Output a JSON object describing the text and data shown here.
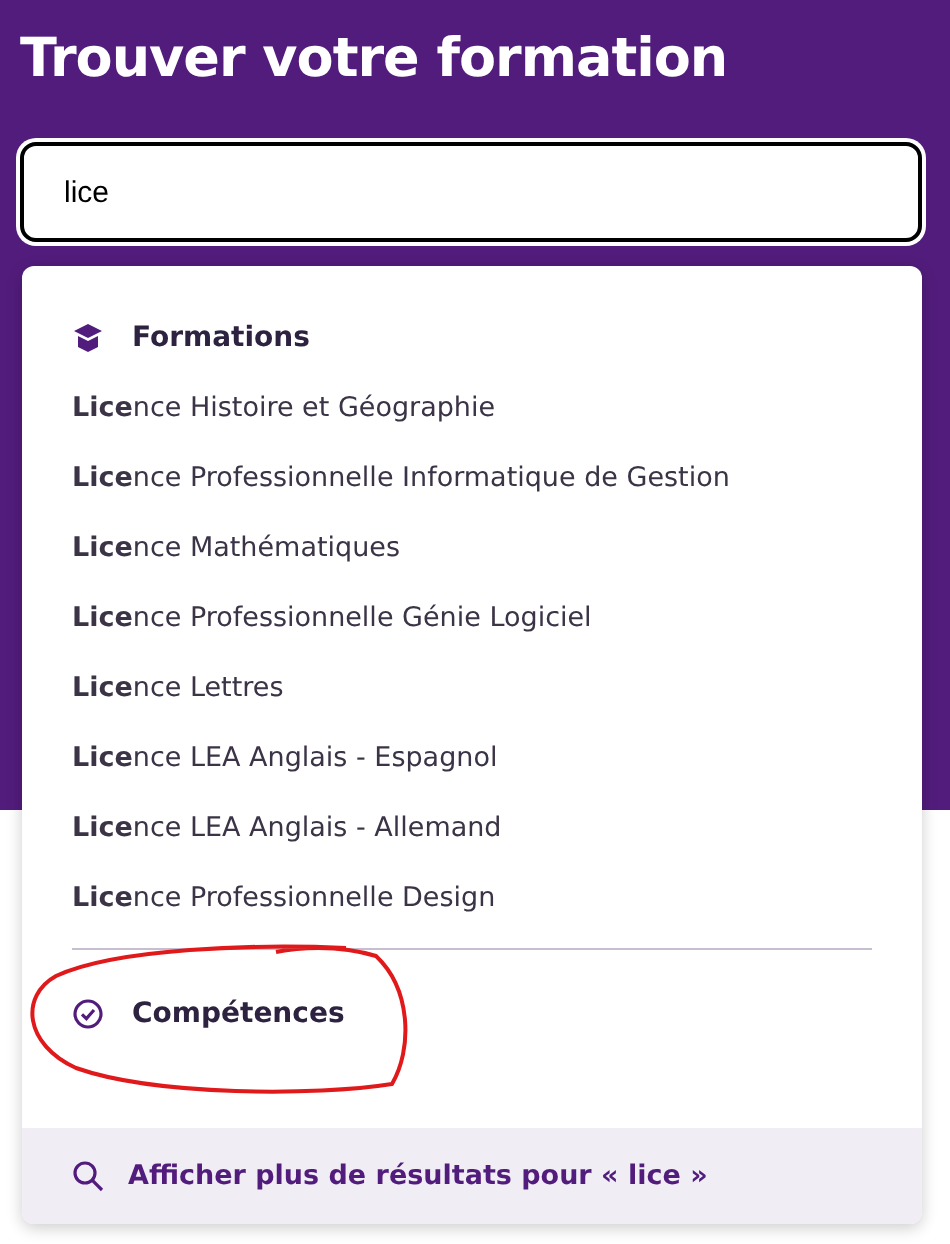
{
  "title": "Trouver votre formation",
  "search": {
    "value": "lice"
  },
  "dropdown": {
    "sections": [
      {
        "kind": "formations",
        "label": "Formations",
        "items": [
          "**Lice**nce Histoire et Géographie",
          "**Lice**nce Professionnelle Informatique de Gestion",
          "**Lice**nce Mathématiques",
          "**Lice**nce Professionnelle Génie Logiciel",
          "**Lice**nce Lettres",
          "**Lice**nce LEA Anglais - Espagnol",
          "**Lice**nce LEA Anglais - Allemand",
          "**Lice**nce Professionnelle Design"
        ]
      },
      {
        "kind": "competences",
        "label": "Compétences"
      }
    ],
    "more_results": "Afficher plus de résultats pour « lice »"
  },
  "annotation": {
    "kind": "ellipse",
    "color": "#e0191b"
  }
}
